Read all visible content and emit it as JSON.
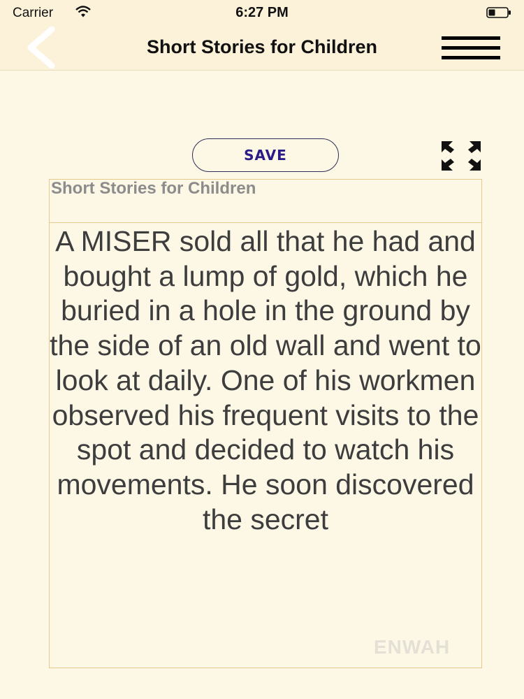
{
  "status_bar": {
    "carrier": "Carrier",
    "time": "6:27 PM"
  },
  "nav": {
    "title": "Short Stories for Children",
    "back_icon": "chevron-left-icon",
    "menu_icon": "hamburger-menu-icon"
  },
  "toolbar": {
    "save_label": "SAVE",
    "expand_icon": "expand-arrows-icon"
  },
  "story": {
    "title": "Short Stories for Children",
    "body": "A MISER sold all that he had and bought a lump of gold, which he buried in a hole in the ground by the side of an old wall and went to look at daily. One of his workmen observed his frequent visits to the spot and decided to watch his movements. He soon discovered the secret"
  },
  "watermark": {
    "text": "ENWAH"
  },
  "colors": {
    "background": "#fdf7e6",
    "bar": "#fbf2d9",
    "save_text": "#2a1b86",
    "panel_border": "#e7c98c",
    "body_text": "#3d3d3d"
  }
}
